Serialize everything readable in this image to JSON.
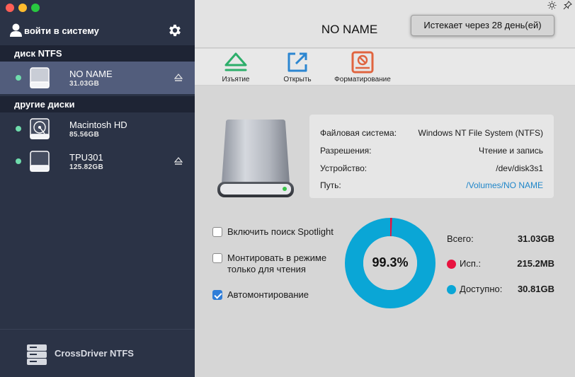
{
  "window": {
    "traffic_lights": [
      "#fe5f57",
      "#febc2e",
      "#28c840"
    ]
  },
  "sidebar": {
    "account_label": "войти в систему",
    "sections": [
      {
        "header": "диск NTFS",
        "disks": [
          {
            "name": "NO NAME",
            "size": "31.03GB",
            "selected": true,
            "icon": "external-drive-icon",
            "ejectable": true
          }
        ]
      },
      {
        "header": "другие диски",
        "disks": [
          {
            "name": "Macintosh HD",
            "size": "85.56GB",
            "selected": false,
            "icon": "internal-hdd-icon",
            "ejectable": false
          },
          {
            "name": "TPU301",
            "size": "125.82GB",
            "selected": false,
            "icon": "external-drive-icon",
            "ejectable": true
          }
        ]
      }
    ],
    "brand_name": "CrossDriver NTFS"
  },
  "header": {
    "title": "NO NAME",
    "expire_text": "Истекает через 28 день(ей)"
  },
  "toolbar": {
    "eject_label": "Изъятие",
    "open_label": "Открыть",
    "format_label": "Форматирование"
  },
  "info": {
    "fs_label": "Файловая система:",
    "fs_value": "Windows NT File System (NTFS)",
    "perm_label": "Разрешения:",
    "perm_value": "Чтение и запись",
    "device_label": "Устройство:",
    "device_value": "/dev/disk3s1",
    "path_label": "Путь:",
    "path_value": "/Volumes/NO NAME"
  },
  "options": [
    {
      "label": "Включить поиск Spotlight",
      "checked": false
    },
    {
      "label": "Монтировать в режиме только для чтения",
      "checked": false
    },
    {
      "label": "Автомонтирование",
      "checked": true
    }
  ],
  "usage": {
    "percent_label": "99.3%",
    "available_fraction": 0.993,
    "total_label": "Всего:",
    "total_value": "31.03GB",
    "used_label": "Исп.:",
    "used_value": "215.2MB",
    "free_label": "Доступно:",
    "free_value": "30.81GB",
    "used_color": "#e8133f",
    "free_color": "#0aa6d6"
  }
}
